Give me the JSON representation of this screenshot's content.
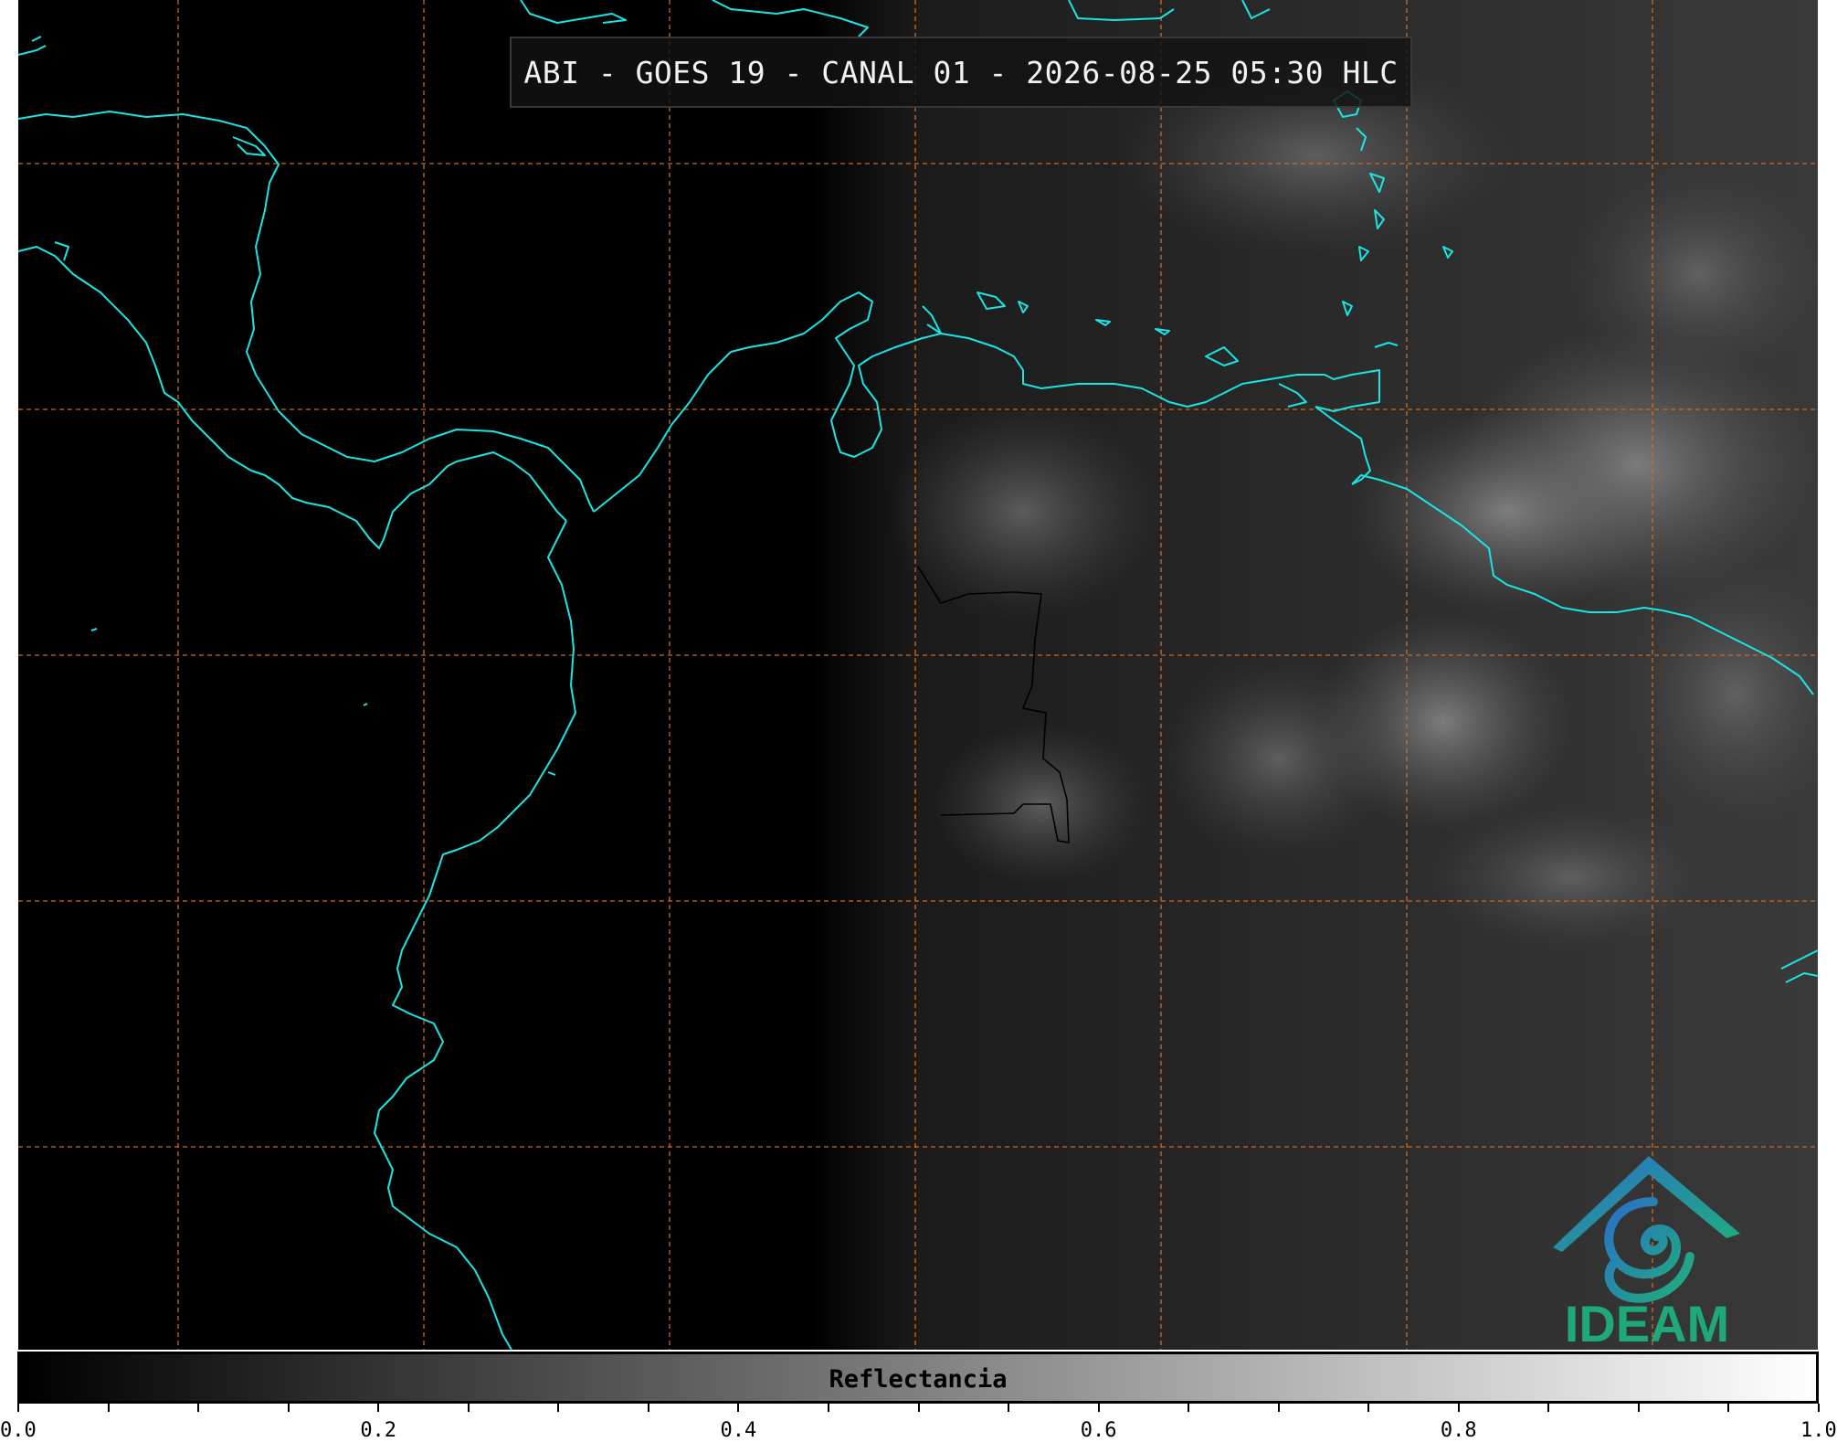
{
  "title": "ABI - GOES 19 - CANAL 01 - 2026-08-25 05:30 HLC",
  "colorbar": {
    "label": "Reflectancia",
    "min": 0.0,
    "max": 1.0,
    "labeled_ticks": [
      "0.0",
      "0.2",
      "0.4",
      "0.6",
      "0.8",
      "1.0"
    ],
    "minor_step": 0.05
  },
  "logo": {
    "text": "IDEAM"
  },
  "colors": {
    "coastline": "#19e5e5",
    "gridline": "#d2691e",
    "border": "#000000",
    "logo_blue": "#2a78c8",
    "logo_green": "#1fa87a"
  },
  "icons": {
    "logo": "ideam-logo-icon"
  }
}
